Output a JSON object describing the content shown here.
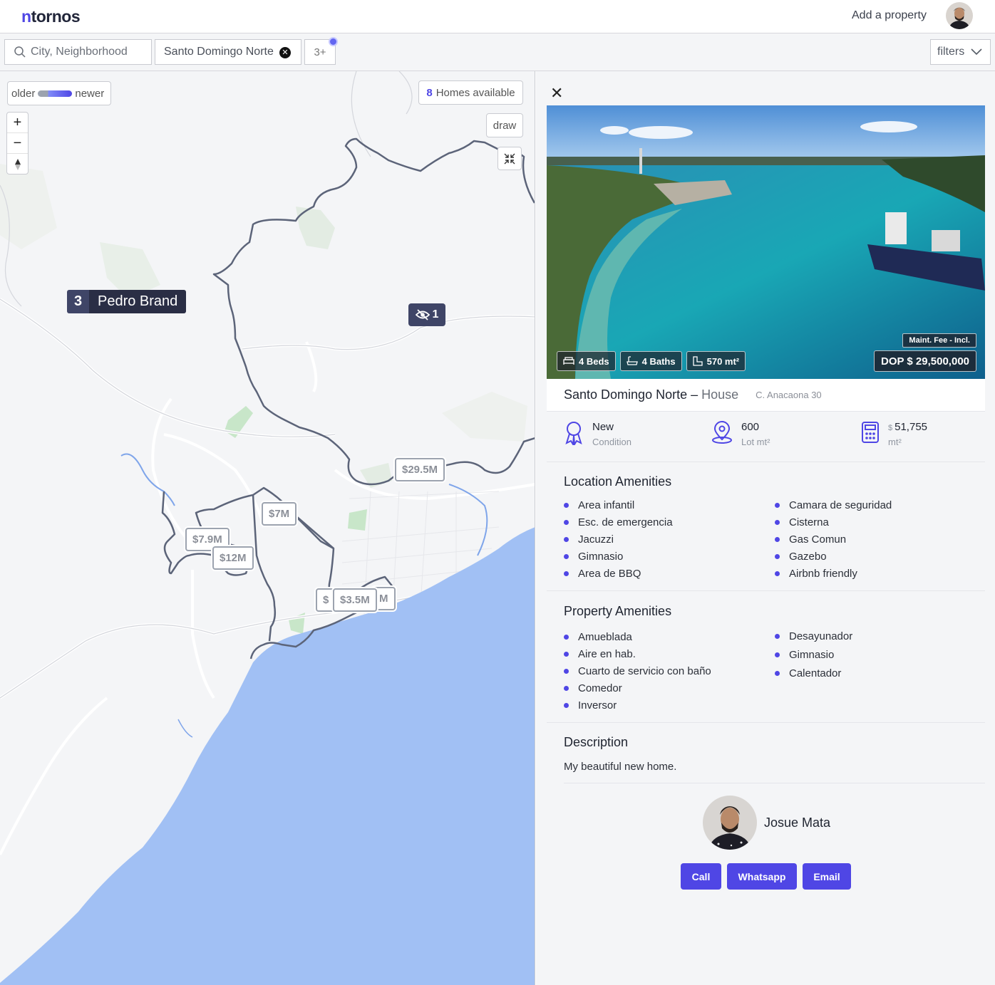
{
  "header": {
    "logo_accent": "n",
    "logo_rest": "tornos",
    "add_property": "Add a property"
  },
  "search": {
    "placeholder": "City, Neighborhood",
    "chip_label": "Santo Domingo Norte",
    "more_label": "3+",
    "filters_label": "filters"
  },
  "map": {
    "toggle_older": "older",
    "toggle_newer": "newer",
    "homes_count": "8",
    "homes_label": "Homes available",
    "draw_label": "draw",
    "region": {
      "count": "3",
      "name": "Pedro Brand"
    },
    "hidden_count": "1",
    "pins": [
      {
        "label": "$29.5M"
      },
      {
        "label": "$7M"
      },
      {
        "label": "$7.9M"
      },
      {
        "label": "$12M"
      },
      {
        "label": "$"
      },
      {
        "label": "M"
      },
      {
        "label": "$3.5M"
      }
    ],
    "colors": {
      "water": "#a1c0f4",
      "boundary": "#5c6479",
      "green": "#c8e6c9"
    }
  },
  "property": {
    "beds": "4 Beds",
    "baths": "4 Baths",
    "area": "570 mt²",
    "maint_fee": "Maint. Fee - Incl.",
    "price": "DOP $ 29,500,000",
    "location": "Santo Domingo Norte",
    "dash": "–",
    "type": "House",
    "address": "C. Anacaona 30",
    "condition_value": "New",
    "condition_label": "Condition",
    "lot_value": "600",
    "lot_label": "Lot mt²",
    "ppm_currency": "$",
    "ppm_value": "51,755",
    "ppm_label": "mt²"
  },
  "location_amenities": {
    "title": "Location Amenities",
    "left": [
      "Area infantil",
      "Esc. de emergencia",
      "Jacuzzi",
      "Gimnasio",
      "Area de BBQ"
    ],
    "right": [
      "Camara de seguridad",
      "Cisterna",
      "Gas Comun",
      "Gazebo",
      "Airbnb friendly"
    ]
  },
  "property_amenities": {
    "title": "Property Amenities",
    "left": [
      "Amueblada",
      "Aire en hab.",
      "Cuarto de servicio con baño",
      "Comedor",
      "Inversor"
    ],
    "right": [
      "Desayunador",
      "Gimnasio",
      "Calentador"
    ]
  },
  "description": {
    "title": "Description",
    "text": "My beautiful new home."
  },
  "agent": {
    "name": "Josue Mata",
    "call": "Call",
    "whatsapp": "Whatsapp",
    "email": "Email"
  },
  "theme": {
    "accent": "#4f46e5"
  }
}
